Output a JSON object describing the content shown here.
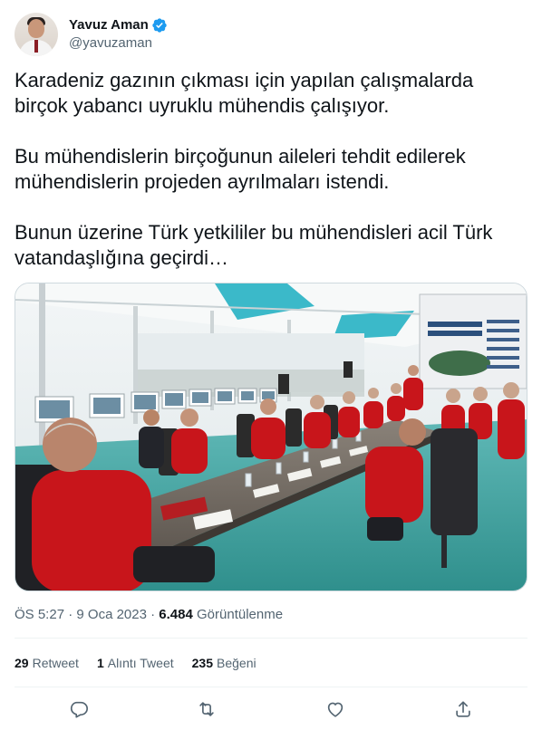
{
  "author": {
    "name": "Yavuz Aman",
    "handle": "@yavuzaman",
    "verified_badge_icon": "verified-badge-icon",
    "verified_color": "#1d9bf0"
  },
  "tweet": {
    "text": "Karadeniz gazının çıkması için yapılan çalışmalarda birçok yabancı uyruklu mühendis çalışıyor.\n\nBu mühendislerin birçoğunun aileleri tehdit edilerek mühendislerin projeden ayrılmaları istendi.\n\nBunun üzerine Türk yetkililer bu mühendisleri acil Türk vatandaşlığına geçirdi…"
  },
  "meta": {
    "time": "ÖS 5:27",
    "separator": "·",
    "date": "9 Oca 2023",
    "views_count": "6.484",
    "views_label": "Görüntülenme"
  },
  "stats": {
    "retweets_count": "29",
    "retweets_label": "Retweet",
    "quotes_count": "1",
    "quotes_label": "Alıntı Tweet",
    "likes_count": "235",
    "likes_label": "Beğeni"
  },
  "actions": [
    {
      "icon": "reply-icon"
    },
    {
      "icon": "retweet-icon"
    },
    {
      "icon": "like-icon"
    },
    {
      "icon": "share-icon"
    }
  ],
  "colors": {
    "text_primary": "#0f1419",
    "text_secondary": "#536471",
    "divider": "#eff3f4",
    "jacket_red": "#c8151b"
  }
}
